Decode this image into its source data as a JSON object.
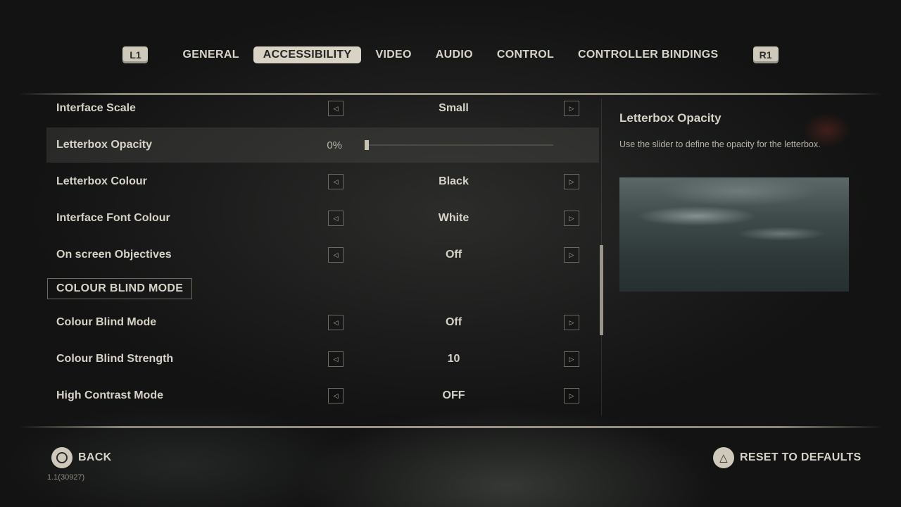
{
  "tabs": {
    "left_bumper": "L1",
    "right_bumper": "R1",
    "items": [
      {
        "label": "GENERAL",
        "active": false
      },
      {
        "label": "ACCESSIBILITY",
        "active": true
      },
      {
        "label": "VIDEO",
        "active": false
      },
      {
        "label": "AUDIO",
        "active": false
      },
      {
        "label": "CONTROL",
        "active": false
      },
      {
        "label": "CONTROLLER BINDINGS",
        "active": false
      }
    ]
  },
  "settings": {
    "interface_scale": {
      "label": "Interface Scale",
      "value": "Small"
    },
    "letterbox_opacity": {
      "label": "Letterbox Opacity",
      "value": "0%",
      "slider_fraction": 0.0
    },
    "letterbox_colour": {
      "label": "Letterbox Colour",
      "value": "Black"
    },
    "interface_font_colour": {
      "label": "Interface Font Colour",
      "value": "White"
    },
    "on_screen_objectives": {
      "label": "On screen Objectives",
      "value": "Off"
    },
    "section_colour_blind": "COLOUR BLIND MODE",
    "colour_blind_mode": {
      "label": "Colour Blind Mode",
      "value": "Off"
    },
    "colour_blind_strength": {
      "label": "Colour Blind Strength",
      "value": "10"
    },
    "high_contrast_mode": {
      "label": "High Contrast Mode",
      "value": "OFF"
    }
  },
  "detail": {
    "title": "Letterbox Opacity",
    "description": "Use the slider to define the opacity for the letterbox."
  },
  "footer": {
    "back_label": "BACK",
    "reset_label": "RESET TO DEFAULTS",
    "version": "1.1(30927)"
  },
  "icons": {
    "arrow_left": "◁",
    "arrow_right": "▷",
    "triangle": "△"
  },
  "colors": {
    "accent": "#d9d3c6",
    "text": "#d6d2c8",
    "background": "#1b1c1b"
  }
}
